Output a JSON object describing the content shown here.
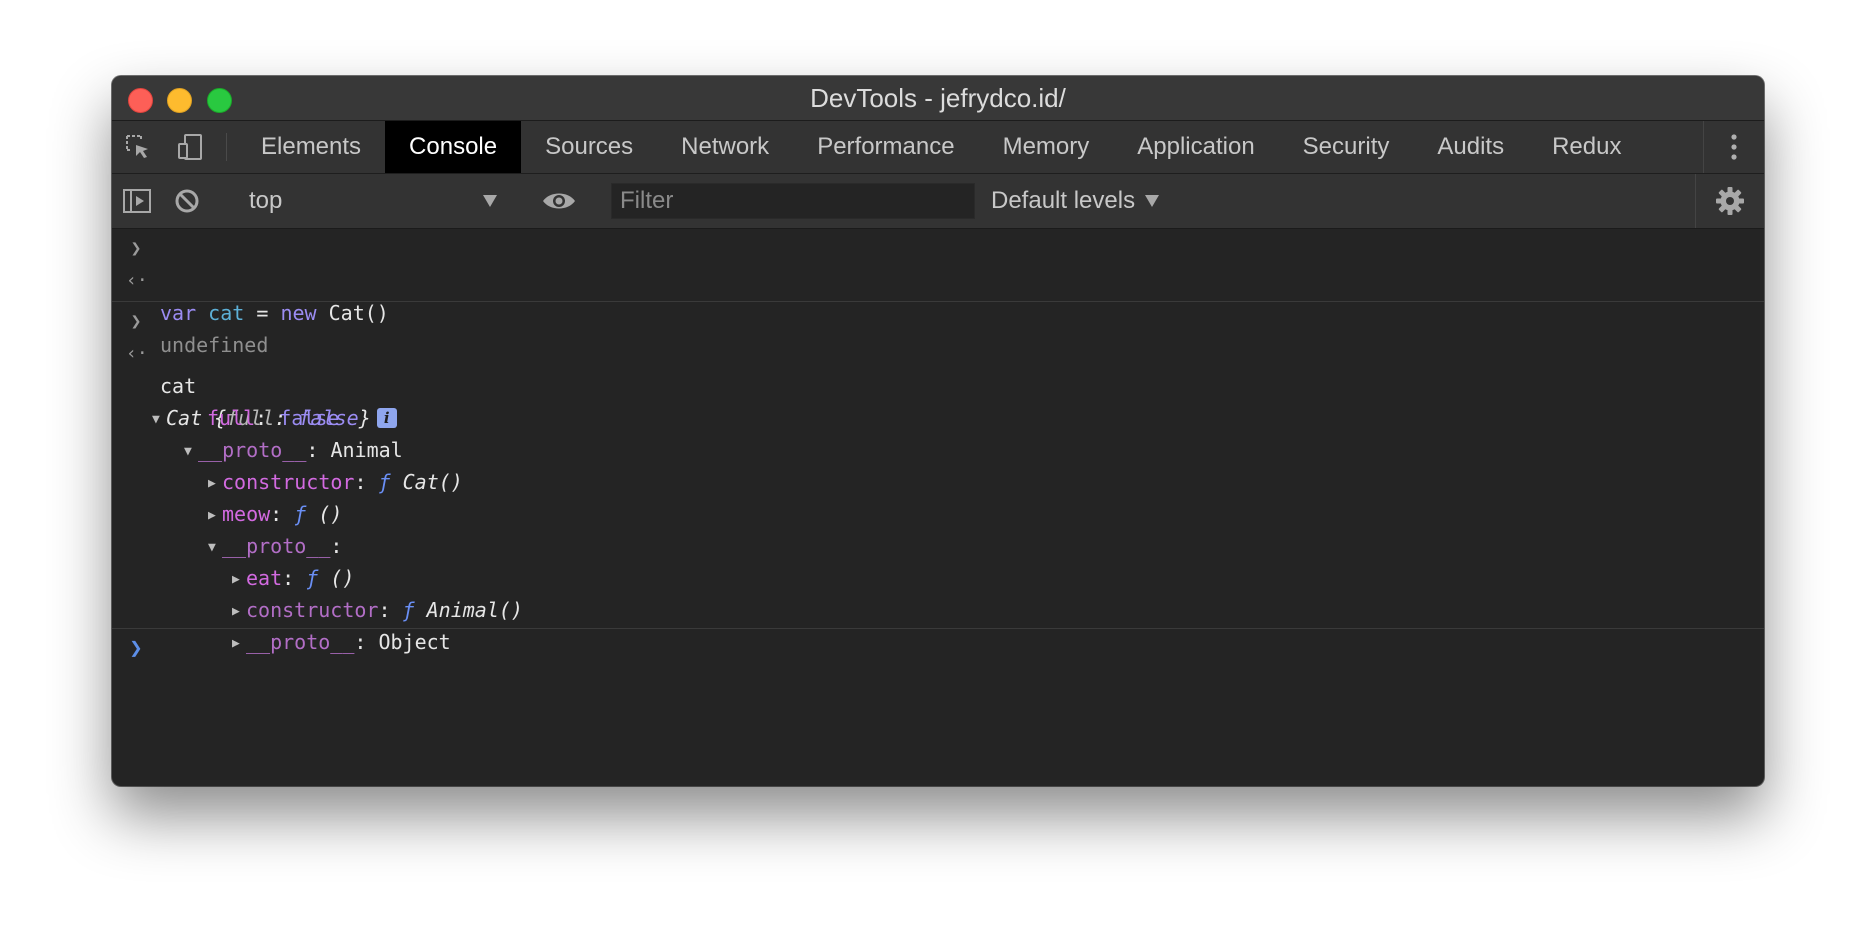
{
  "window": {
    "title": "DevTools - jefrydco.id/"
  },
  "tabs": [
    {
      "label": "Elements",
      "active": false
    },
    {
      "label": "Console",
      "active": true
    },
    {
      "label": "Sources",
      "active": false
    },
    {
      "label": "Network",
      "active": false
    },
    {
      "label": "Performance",
      "active": false
    },
    {
      "label": "Memory",
      "active": false
    },
    {
      "label": "Application",
      "active": false
    },
    {
      "label": "Security",
      "active": false
    },
    {
      "label": "Audits",
      "active": false
    },
    {
      "label": "Redux",
      "active": false
    }
  ],
  "toolbar": {
    "context": "top",
    "filter_placeholder": "Filter",
    "levels": "Default levels"
  },
  "console": {
    "entry1": {
      "input": {
        "kw1": "var",
        "var": "cat",
        "eq": "=",
        "kw2": "new",
        "call": "Cat()"
      },
      "output": "undefined"
    },
    "entry2": {
      "input": "cat",
      "summary": {
        "name": "Cat",
        "open": "{",
        "key": "full",
        "colon": ":",
        "value": "false",
        "close": "}",
        "info": "i"
      },
      "tree": {
        "full_key": "full",
        "full_value": "false",
        "proto_key": "__proto__",
        "proto_value": "Animal",
        "constructor_key": "constructor",
        "constructor_f": "ƒ",
        "constructor_value": "Cat()",
        "meow_key": "meow",
        "meow_f": "ƒ",
        "meow_value": "()",
        "proto2_key": "__proto__",
        "eat_key": "eat",
        "eat_f": "ƒ",
        "eat_value": "()",
        "constructor2_key": "constructor",
        "constructor2_f": "ƒ",
        "constructor2_value": "Animal()",
        "proto3_key": "__proto__",
        "proto3_value": "Object"
      }
    }
  },
  "colors": {
    "keyword": "#9b8cf2",
    "variable": "#5db0d7",
    "property": "#d26ae0",
    "function": "#6a8ff5",
    "prompt": "#5d8fe8"
  }
}
